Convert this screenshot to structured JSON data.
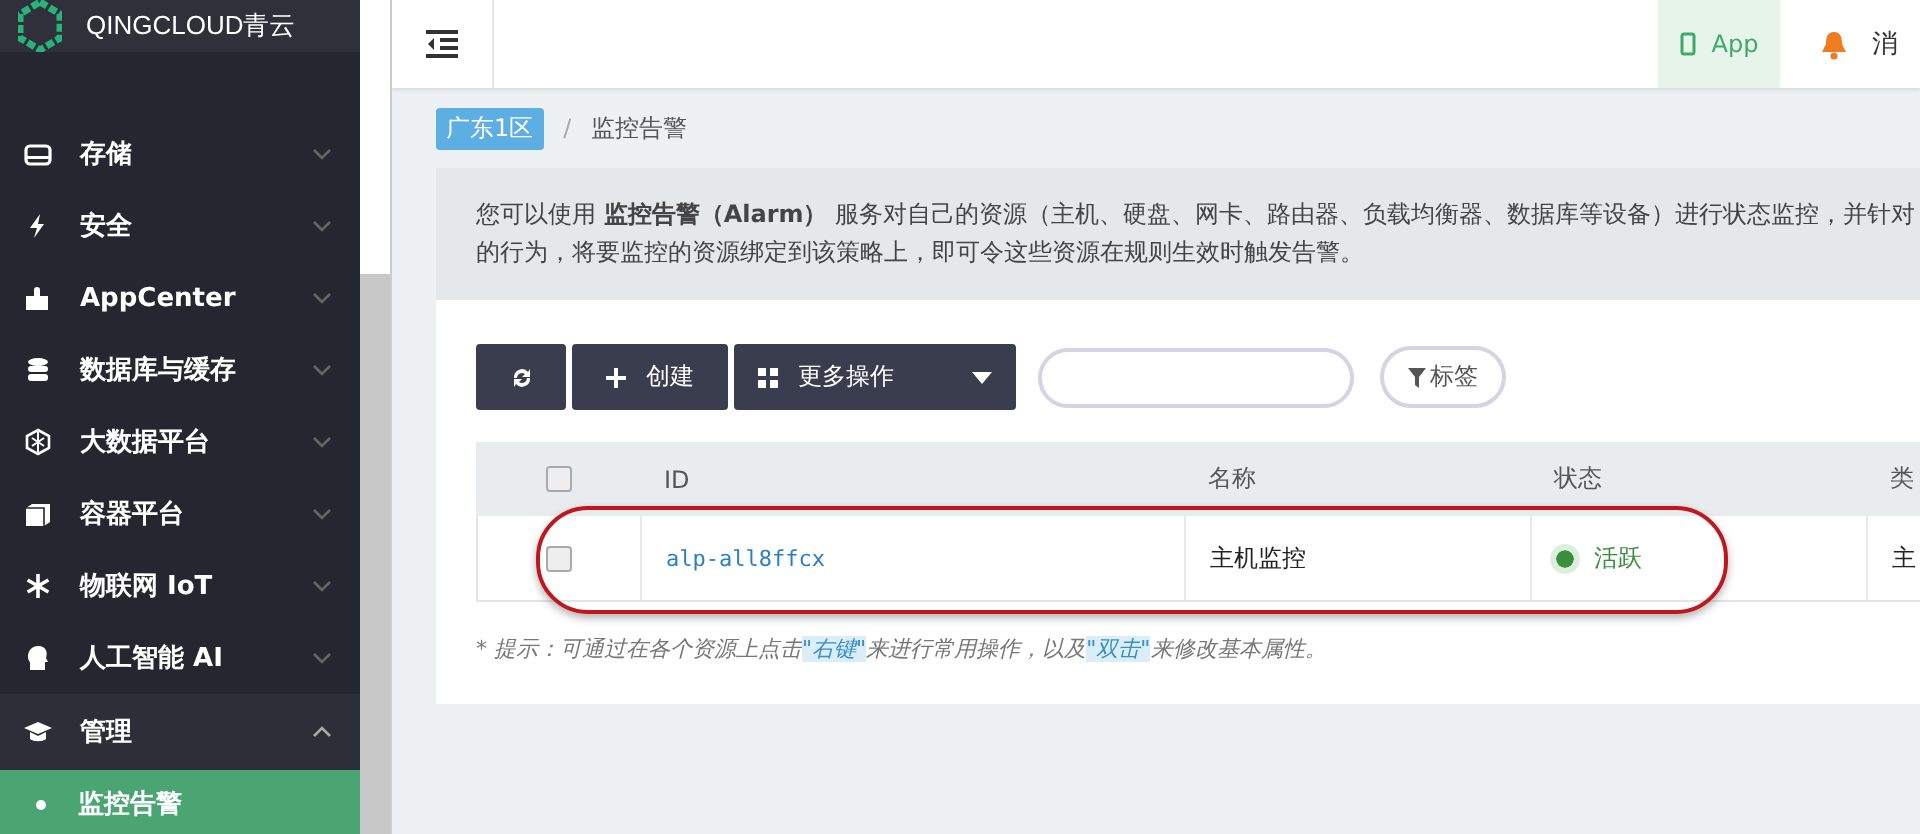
{
  "brand": {
    "name": "QINGCLOUD青云"
  },
  "sidebar": {
    "items": [
      {
        "label": "存储",
        "expanded": false
      },
      {
        "label": "安全",
        "expanded": false
      },
      {
        "label": "AppCenter",
        "expanded": false
      },
      {
        "label": "数据库与缓存",
        "expanded": false
      },
      {
        "label": "大数据平台",
        "expanded": false
      },
      {
        "label": "容器平台",
        "expanded": false
      },
      {
        "label": "物联网 IoT",
        "expanded": false
      },
      {
        "label": "人工智能 AI",
        "expanded": false
      },
      {
        "label": "管理",
        "expanded": true,
        "children": [
          {
            "label": "监控告警",
            "selected": true
          }
        ]
      }
    ]
  },
  "header": {
    "app_button": "App",
    "notice": "消"
  },
  "breadcrumb": {
    "region": "广东1区",
    "separator": "/",
    "page": "监控告警"
  },
  "info": {
    "lines": [
      "您可以使用 **监控告警（Alarm）** 服务对自己的资源（主机、硬盘、网卡、路由器、负载均衡器、数据库等设备）进行状态监控，并针对",
      "的行为，将要监控的资源绑定到该策略上，即可令这些资源在规则生效时触发告警。"
    ]
  },
  "toolbar": {
    "create": "创建",
    "more": "更多操作",
    "tag_filter": "标签"
  },
  "table": {
    "columns": [
      "ID",
      "名称",
      "状态",
      "类"
    ],
    "select_all_checked": false,
    "rows": [
      {
        "checked": false,
        "id": "alp-all8ffcx",
        "name": "主机监控",
        "status": "活跃",
        "color": "#3a8f3e",
        "column_5": "主"
      }
    ]
  },
  "hint": [
    {
      "text": "* 提示：可通过在各个资源上点击",
      "highlight": false
    },
    {
      "text": "\"右键\"",
      "highlight": true
    },
    {
      "text": "来进行常用操作，以及",
      "highlight": false
    },
    {
      "text": "\"双击\"",
      "highlight": true
    },
    {
      "text": "来修改基本属性。",
      "highlight": false
    }
  ],
  "annotation": {
    "kind": "ellipse"
  }
}
